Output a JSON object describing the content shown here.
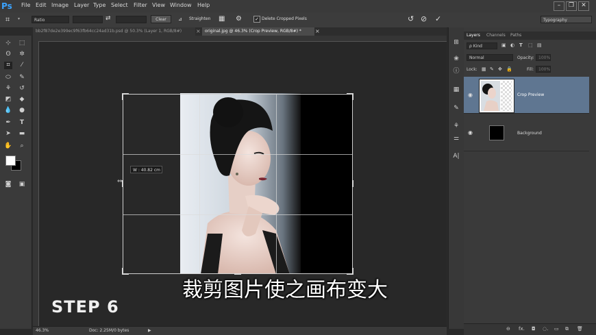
{
  "app": {
    "logo": "Ps"
  },
  "menu": [
    "File",
    "Edit",
    "Image",
    "Layer",
    "Type",
    "Select",
    "Filter",
    "View",
    "Window",
    "Help"
  ],
  "window_controls": {
    "minimize": "–",
    "restore": "❐",
    "close": "✕"
  },
  "options": {
    "ratio_label": "Ratio",
    "swap_icon": "⇄",
    "clear_label": "Clear",
    "straighten_label": "Straighten",
    "delete_cropped_label": "Delete Cropped Pixels",
    "delete_cropped_checked": true,
    "workspace": "Typography"
  },
  "tabs": [
    {
      "label": "bb2f87de2e399ec9f63fb64cc24ad31b.psd @ 50.3% (Layer 1, RGB/8#)",
      "active": false,
      "close": "×"
    },
    {
      "label": "original.jpg @ 46.3% (Crop Preview, RGB/8#) *",
      "active": true,
      "close": "×"
    }
  ],
  "canvas": {
    "measure_tooltip": "W :  40.82 cm"
  },
  "overlay": {
    "step": "STEP 6",
    "subtitle": "裁剪图片使之画布变大"
  },
  "status": {
    "zoom": "46.3%",
    "doc": "Doc: 2.25M/0 bytes",
    "arrow": "▶"
  },
  "layers_panel": {
    "tabs": [
      "Layers",
      "Channels",
      "Paths"
    ],
    "filter_kind": "ρ Kind",
    "blend_mode": "Normal",
    "opacity_label": "Opacity:",
    "opacity_value": "100%",
    "lock_label": "Lock:",
    "fill_label": "Fill:",
    "fill_value": "100%",
    "layers": [
      {
        "name": "Crop Preview",
        "selected": true,
        "visible": true
      },
      {
        "name": "Background",
        "selected": false,
        "visible": true
      }
    ],
    "footer_icons": [
      "⊖",
      "fx.",
      "◘",
      "◌.",
      "▭",
      "⧉",
      "🗑"
    ]
  },
  "colors": {
    "accent": "#3ba3ff",
    "selected_layer": "#5f7691",
    "panel": "#3a3a3a",
    "canvas": "#282828"
  }
}
